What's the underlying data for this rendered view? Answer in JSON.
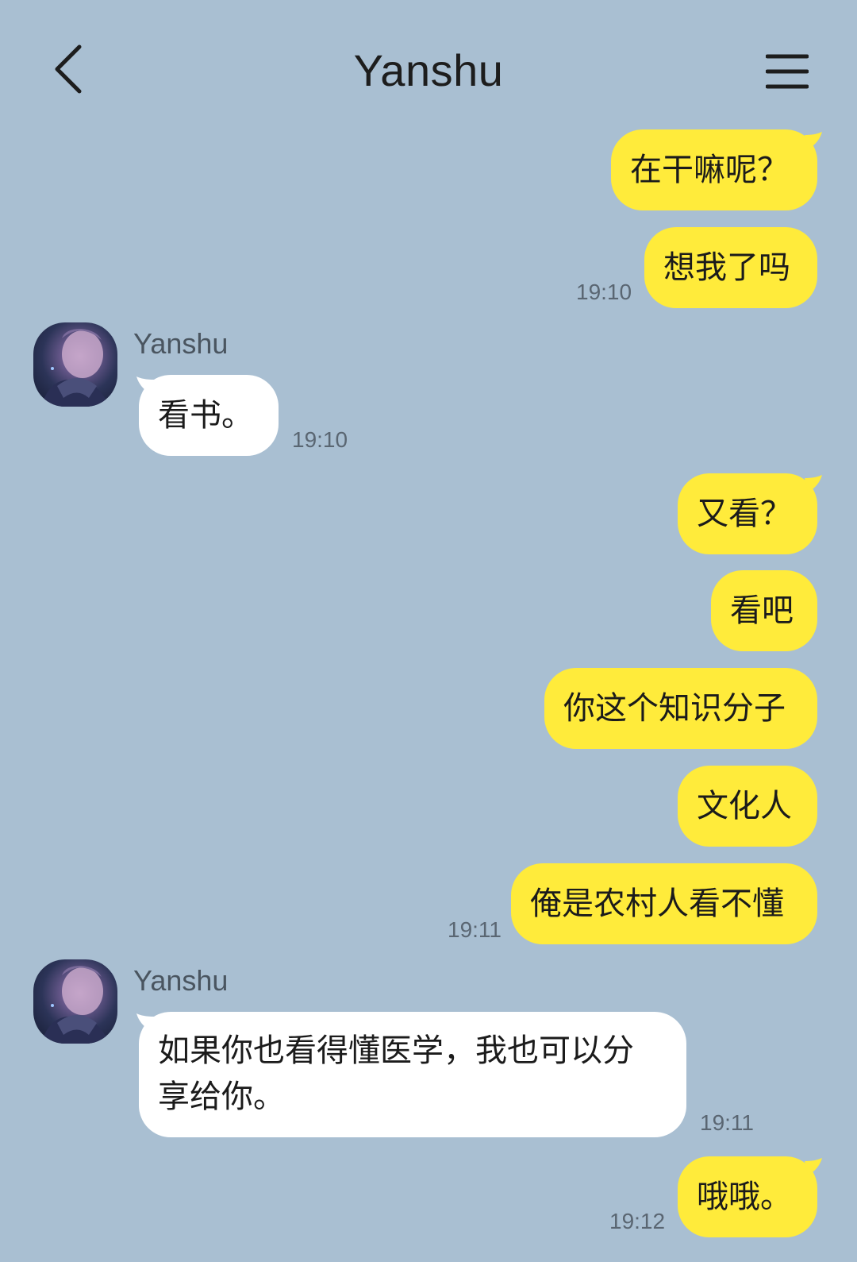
{
  "header": {
    "title": "Yanshu"
  },
  "messages": {
    "m1": "在干嘛呢？",
    "m2": "想我了吗",
    "t1": "19:10",
    "sender1": "Yanshu",
    "m3": "看书。",
    "t2": "19:10",
    "m4": "又看？",
    "m5": "看吧",
    "m6": "你这个知识分子",
    "m7": "文化人",
    "m8": "俺是农村人看不懂",
    "t3": "19:11",
    "sender2": "Yanshu",
    "m9_line1": "如果你也看得懂医学，我也可以分",
    "m9_line2": "享给你。",
    "t4": "19:11",
    "m10": "哦哦。",
    "t5": "19:12"
  },
  "colors": {
    "background": "#a9bfd2",
    "my_bubble": "#ffeb3b",
    "their_bubble": "#ffffff"
  }
}
